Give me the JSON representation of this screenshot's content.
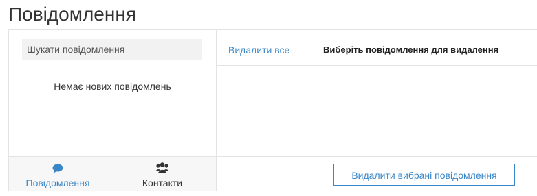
{
  "page": {
    "title": "Повідомлення"
  },
  "search": {
    "placeholder": "Шукати повідомлення"
  },
  "messages_list": {
    "empty_text": "Немає нових повідомлень"
  },
  "tabs": [
    {
      "label": "Повідомлення",
      "icon": "chat-bubble-icon",
      "active": true
    },
    {
      "label": "Контакти",
      "icon": "users-icon",
      "active": false
    }
  ],
  "actions": {
    "delete_all_label": "Видалити все",
    "select_prompt": "Виберіть повідомлення для видалення",
    "delete_selected_label": "Видалити вибрані повідомлення"
  },
  "colors": {
    "accent": "#3a87c8",
    "border": "#e3e3e3",
    "footer_bg": "#f7f7f7",
    "search_bg": "#f2f2f2"
  }
}
